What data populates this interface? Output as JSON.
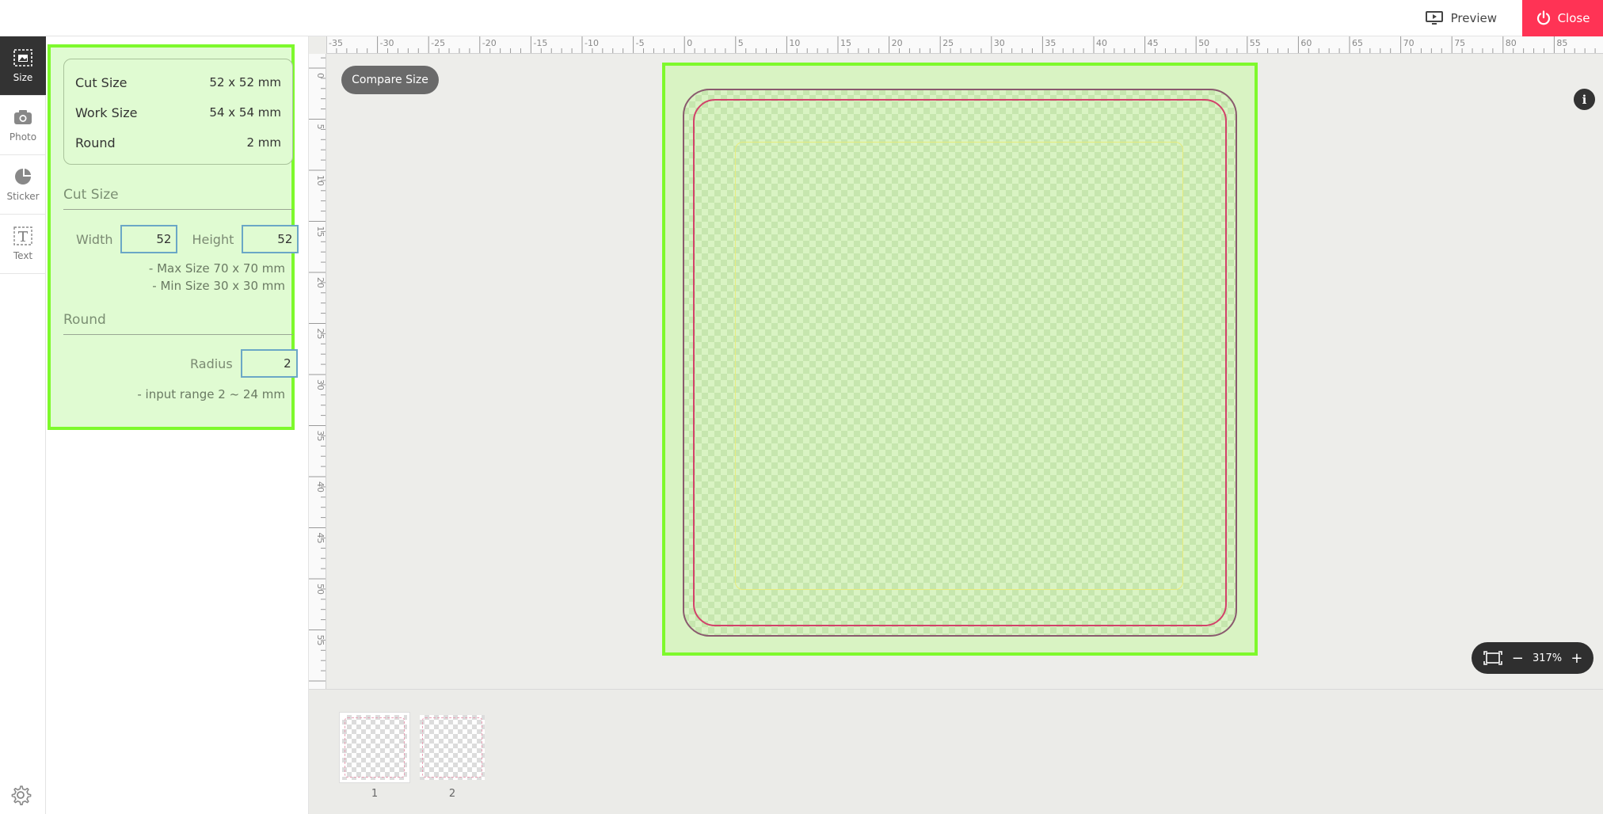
{
  "topbar": {
    "preview_label": "Preview",
    "close_label": "Close"
  },
  "rail": {
    "items": [
      {
        "label": "Size",
        "icon": "size-icon",
        "active": true
      },
      {
        "label": "Photo",
        "icon": "camera-icon"
      },
      {
        "label": "Sticker",
        "icon": "sticker-icon"
      },
      {
        "label": "Text",
        "icon": "text-icon"
      }
    ]
  },
  "panel": {
    "summary": {
      "cut_size_label": "Cut Size",
      "cut_size_value": "52 x 52 mm",
      "work_size_label": "Work Size",
      "work_size_value": "54 x 54 mm",
      "round_label": "Round",
      "round_value": "2 mm"
    },
    "cut_section_title": "Cut Size",
    "width_label": "Width",
    "width_value": "52",
    "height_label": "Height",
    "height_value": "52",
    "max_hint": "- Max Size 70 x 70 mm",
    "min_hint": "- Min Size 30 x 30 mm",
    "round_section_title": "Round",
    "radius_label": "Radius",
    "radius_value": "2",
    "range_hint": "- input range 2 ~ 24 mm"
  },
  "workspace": {
    "compare_label": "Compare Size",
    "info_label": "i",
    "zoom_minus": "−",
    "zoom_value": "317%",
    "zoom_plus": "+",
    "ruler_top_labels": [
      "-35",
      "-30",
      "-25",
      "-20",
      "-15",
      "-10",
      "-5",
      "0",
      "5",
      "10",
      "15",
      "20",
      "25",
      "30",
      "35",
      "40",
      "45",
      "50",
      "55",
      "60",
      "65",
      "70",
      "75",
      "80",
      "85"
    ],
    "ruler_left_labels": [
      "0",
      "5",
      "10",
      "15",
      "20",
      "25",
      "30",
      "35",
      "40",
      "45",
      "50",
      "55"
    ]
  },
  "thumbnails": [
    {
      "label": "1",
      "active": true
    },
    {
      "label": "2",
      "active": false
    }
  ],
  "colors": {
    "close_bg": "#ff3355",
    "highlight": "#7ef92c",
    "cut_line": "#d2426a",
    "work_line": "#8a5a6e",
    "safe_line": "#e7ec7c"
  }
}
